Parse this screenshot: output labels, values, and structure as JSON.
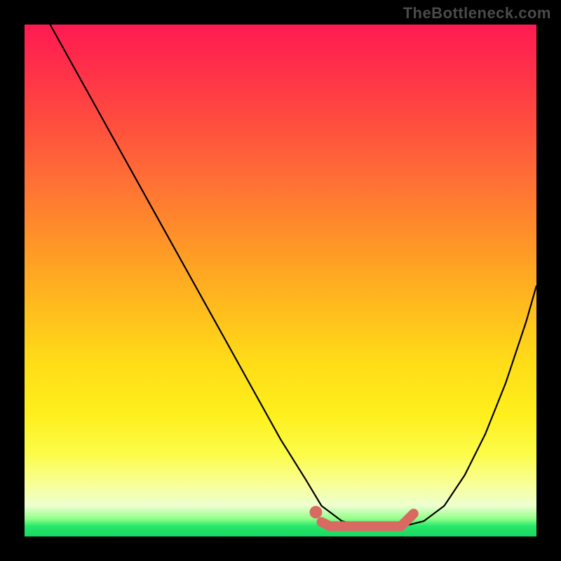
{
  "watermark": "TheBottleneck.com",
  "chart_data": {
    "type": "line",
    "title": "",
    "xlabel": "",
    "ylabel": "",
    "x_range": [
      0,
      100
    ],
    "y_range": [
      0,
      100
    ],
    "series": [
      {
        "name": "bottleneck-curve",
        "x": [
          5,
          10,
          15,
          20,
          25,
          30,
          35,
          40,
          45,
          50,
          55,
          58,
          62,
          66,
          70,
          74,
          78,
          82,
          86,
          90,
          94,
          98,
          100
        ],
        "values": [
          100,
          91,
          82,
          73,
          64,
          55,
          46,
          37,
          28,
          19,
          11,
          6,
          3,
          2,
          2,
          2,
          3,
          6,
          12,
          20,
          30,
          42,
          49
        ]
      }
    ],
    "highlight": {
      "name": "optimal-range",
      "x_start": 58,
      "x_end": 76,
      "y": 2
    },
    "gradient": {
      "top": "#ff1a52",
      "mid": "#ffdc18",
      "bottom": "#18d862"
    }
  }
}
